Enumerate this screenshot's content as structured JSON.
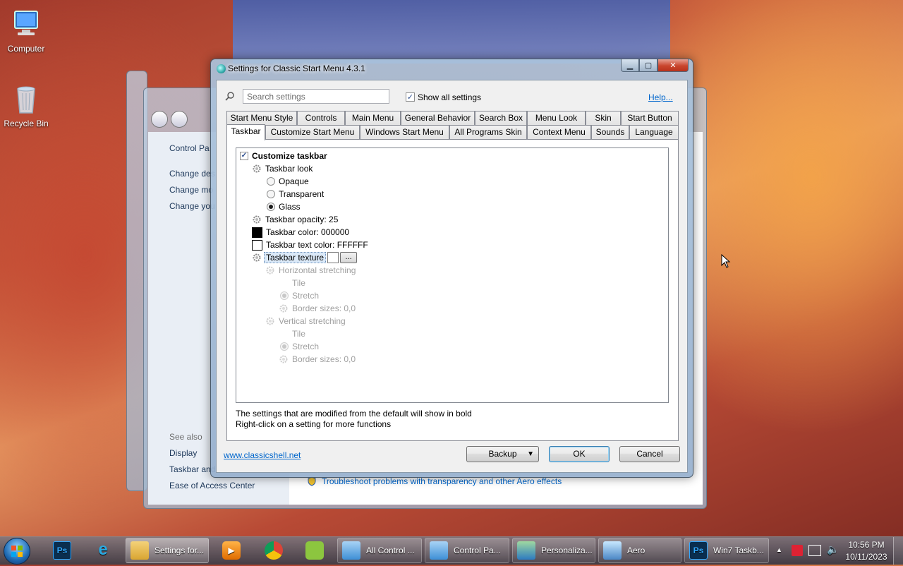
{
  "desktop": {
    "icons": [
      {
        "label": "Computer",
        "icon": "computer-icon"
      },
      {
        "label": "Recycle Bin",
        "icon": "recycle-bin-icon"
      }
    ]
  },
  "control_panel": {
    "breadcrumb": "Control Pa",
    "links": [
      "Change des",
      "Change mo",
      "Change you"
    ],
    "see_also_heading": "See also",
    "see_also": [
      "Display",
      "Taskbar and",
      "Ease of Access Center"
    ],
    "troubleshoot_link": "Troubleshoot problems with transparency and other Aero effects"
  },
  "dialog": {
    "title": "Settings for Classic Start Menu 4.3.1",
    "search_placeholder": "Search settings",
    "show_all_label": "Show all settings",
    "show_all_checked": true,
    "help_link": "Help...",
    "tabs_row1": [
      "Start Menu Style",
      "Controls",
      "Main Menu",
      "General Behavior",
      "Search Box",
      "Menu Look",
      "Skin",
      "Start Button"
    ],
    "tabs_row2": [
      "Taskbar",
      "Customize Start Menu",
      "Windows Start Menu",
      "All Programs Skin",
      "Context Menu",
      "Sounds",
      "Language"
    ],
    "active_tab": "Taskbar",
    "tree": {
      "customize": "Customize taskbar",
      "taskbar_look": "Taskbar look",
      "opaque": "Opaque",
      "transparent": "Transparent",
      "glass": "Glass",
      "opacity": "Taskbar opacity: 25",
      "color": "Taskbar color: 000000",
      "text_color": "Taskbar text color: FFFFFF",
      "texture": "Taskbar texture",
      "texture_browse": "...",
      "h_stretch": "Horizontal stretching",
      "h_tile": "Tile",
      "h_stretch_opt": "Stretch",
      "h_border": "Border sizes: 0,0",
      "v_stretch": "Vertical stretching",
      "v_tile": "Tile",
      "v_stretch_opt": "Stretch",
      "v_border": "Border sizes: 0,0"
    },
    "colors": {
      "taskbar_color": "#000000",
      "text_color": "#FFFFFF"
    },
    "info_line1": "The settings that are modified from the default will show in bold",
    "info_line2": "Right-click on a setting for more functions",
    "website": "www.classicshell.net",
    "backup": "Backup",
    "ok": "OK",
    "cancel": "Cancel"
  },
  "taskbar": {
    "items": [
      {
        "label": "Settings for...",
        "icon": "folder-icon",
        "active": true
      },
      {
        "label": "All Control ...",
        "icon": "control-panel-icon"
      },
      {
        "label": "Control Pa...",
        "icon": "control-panel-icon"
      },
      {
        "label": "Personaliza...",
        "icon": "personalization-icon"
      },
      {
        "label": "Aero",
        "icon": "aero-icon"
      },
      {
        "label": "Win7 Taskb...",
        "icon": "photoshop-icon"
      }
    ],
    "pinned": [
      "photoshop-icon",
      "internet-explorer-icon",
      "media-player-icon",
      "chrome-icon",
      "app-icon"
    ],
    "time": "10:56 PM",
    "date": "10/11/2023"
  }
}
